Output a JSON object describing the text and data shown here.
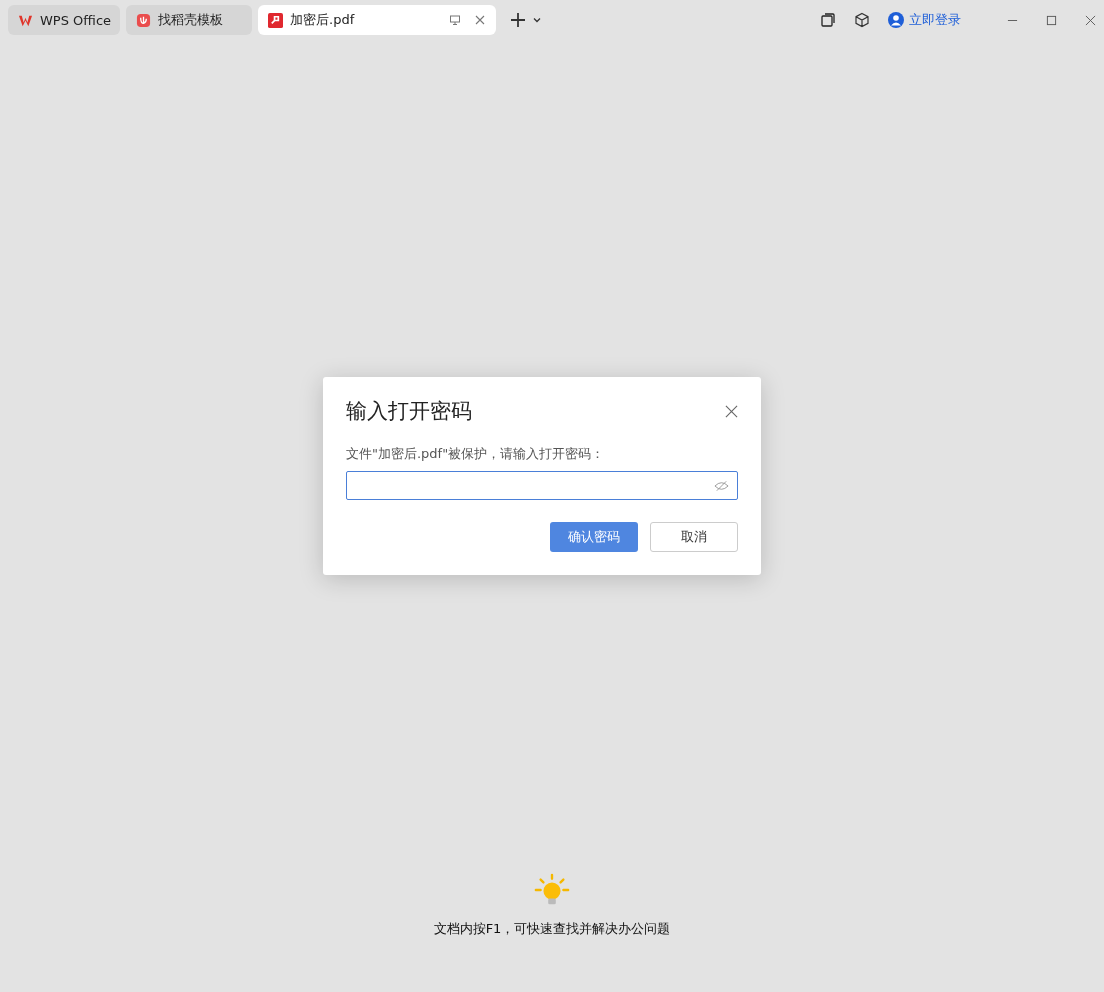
{
  "tabs": [
    {
      "label": "WPS Office",
      "kind": "wps",
      "selected": false
    },
    {
      "label": "找稻壳模板",
      "kind": "template",
      "selected": false
    },
    {
      "label": "加密后.pdf",
      "kind": "pdf",
      "selected": true
    }
  ],
  "account": {
    "label": "立即登录"
  },
  "dialog": {
    "title": "输入打开密码",
    "message": "文件\"加密后.pdf\"被保护，请输入打开密码：",
    "password": {
      "masked": true
    },
    "buttons": [
      {
        "label": "确认密码",
        "kind": "primary"
      },
      {
        "label": "取消",
        "kind": "secondary"
      }
    ]
  },
  "tip": {
    "text": "文档内按F1，可快速查找并解决办公问题"
  }
}
